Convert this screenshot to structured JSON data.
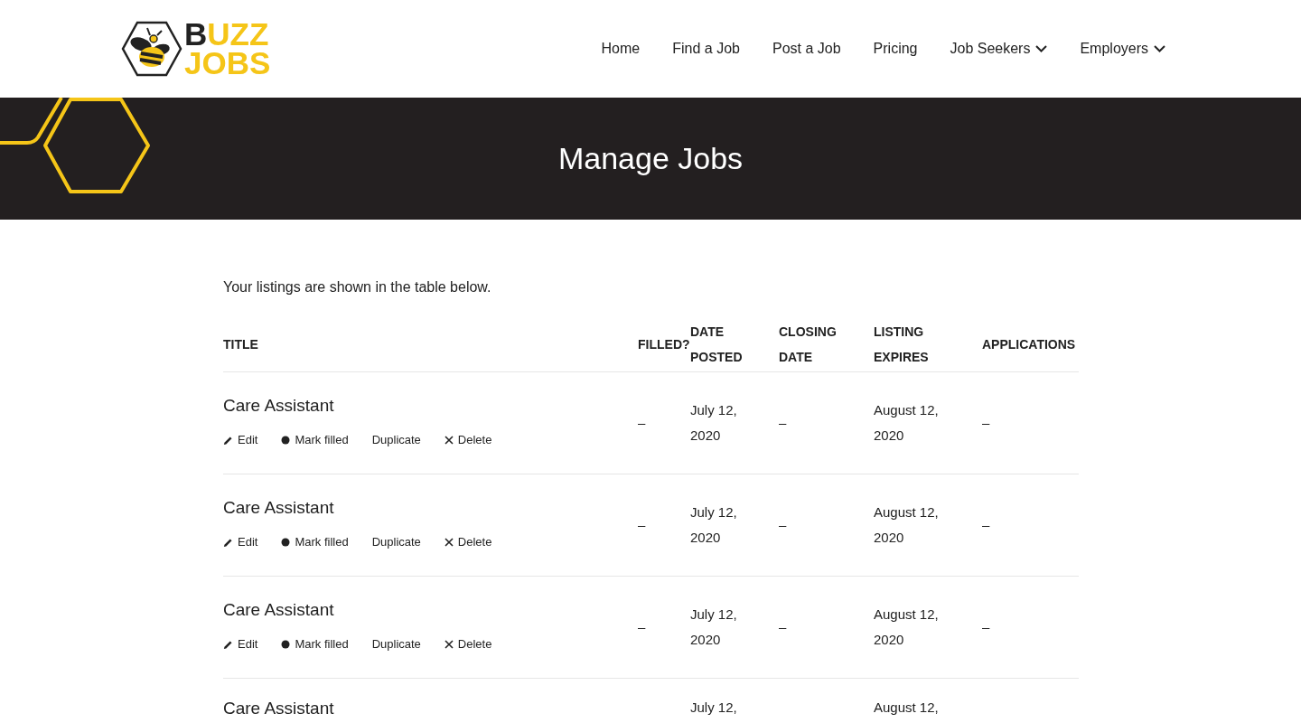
{
  "logo": {
    "lead": "B",
    "rest": "UZZ",
    "second_line": "JOBS"
  },
  "nav": [
    {
      "label": "Home",
      "dropdown": false
    },
    {
      "label": "Find a Job",
      "dropdown": false
    },
    {
      "label": "Post a Job",
      "dropdown": false
    },
    {
      "label": "Pricing",
      "dropdown": false
    },
    {
      "label": "Job Seekers",
      "dropdown": true
    },
    {
      "label": "Employers",
      "dropdown": true
    }
  ],
  "banner": {
    "title": "Manage Jobs"
  },
  "intro": "Your listings are shown in the table below.",
  "table": {
    "columns": [
      "TITLE",
      "FILLED?",
      "DATE POSTED",
      "CLOSING DATE",
      "LISTING EXPIRES",
      "APPLICATIONS"
    ],
    "rows": [
      {
        "title": "Care Assistant",
        "actions": [
          {
            "kind": "edit",
            "label": "Edit"
          },
          {
            "kind": "mark",
            "label": "Mark filled"
          },
          {
            "kind": "duplicate",
            "label": "Duplicate"
          },
          {
            "kind": "delete",
            "label": "Delete"
          }
        ],
        "filled": "–",
        "date_posted": "July 12, 2020",
        "closing_date": "–",
        "listing_expires": "August 12, 2020",
        "applications": "–"
      },
      {
        "title": "Care Assistant",
        "actions": [
          {
            "kind": "edit",
            "label": "Edit"
          },
          {
            "kind": "mark",
            "label": "Mark filled"
          },
          {
            "kind": "duplicate",
            "label": "Duplicate"
          },
          {
            "kind": "delete",
            "label": "Delete"
          }
        ],
        "filled": "–",
        "date_posted": "July 12, 2020",
        "closing_date": "–",
        "listing_expires": "August 12, 2020",
        "applications": "–"
      },
      {
        "title": "Care Assistant",
        "actions": [
          {
            "kind": "edit",
            "label": "Edit"
          },
          {
            "kind": "mark",
            "label": "Mark filled"
          },
          {
            "kind": "duplicate",
            "label": "Duplicate"
          },
          {
            "kind": "delete",
            "label": "Delete"
          }
        ],
        "filled": "–",
        "date_posted": "July 12, 2020",
        "closing_date": "–",
        "listing_expires": "August 12, 2020",
        "applications": "–"
      },
      {
        "title": "Care Assistant",
        "date_posted": "July 12,",
        "listing_expires": "August 12,"
      }
    ]
  }
}
